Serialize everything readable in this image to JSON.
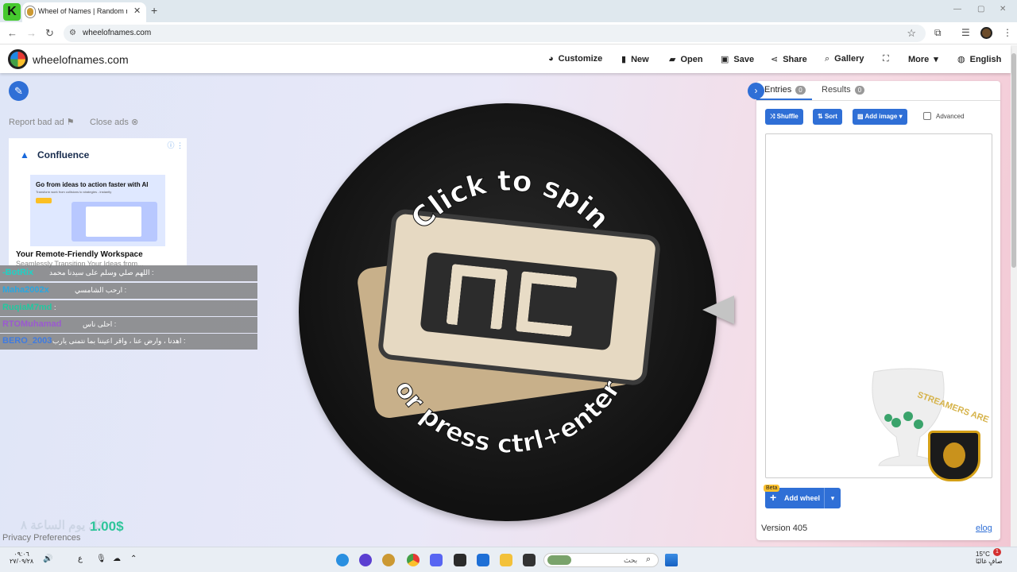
{
  "browser": {
    "tab_logo": "K",
    "tab_title": "Wheel of Names | Random nam",
    "tab_close": "✕",
    "new_tab": "+",
    "url": "wheelofnames.com",
    "win_min": "—",
    "win_max": "▢",
    "win_close": "✕"
  },
  "header": {
    "site_name": "wheelofnames.com",
    "menu": [
      {
        "label": "Customize",
        "icon": "palette-icon",
        "glyph": "◕"
      },
      {
        "label": "New",
        "icon": "file-icon",
        "glyph": "▮"
      },
      {
        "label": "Open",
        "icon": "folder-icon",
        "glyph": "▰"
      },
      {
        "label": "Save",
        "icon": "save-icon",
        "glyph": "▣"
      },
      {
        "label": "Share",
        "icon": "share-icon",
        "glyph": "⋖"
      },
      {
        "label": "Gallery",
        "icon": "search-icon",
        "glyph": "⌕"
      },
      {
        "label": "",
        "icon": "fullscreen-icon",
        "glyph": "⛶"
      },
      {
        "label": "More",
        "icon": "chevron-down-icon",
        "glyph": "▾"
      },
      {
        "label": "English",
        "icon": "globe-icon",
        "glyph": "◍"
      }
    ]
  },
  "ad": {
    "report": "Report bad ad",
    "close": "Close ads",
    "brand": "Confluence",
    "image_title": "Go from ideas to action faster with AI",
    "image_sub": "Transform work from collisions to strategies - instantly",
    "title": "Your Remote-Friendly Workspace",
    "desc": "Seamlessly Transition Your Ideas from..."
  },
  "chat": [
    {
      "user": "-BotRix",
      "msg": "اللهم صلي وسلم على سيدنا محمد :",
      "color": "#1fd3c6"
    },
    {
      "user": "Maha2002x",
      "msg": "ارحب الشامسي :",
      "color": "#2aa7e0"
    },
    {
      "user": "RuqiaM7md",
      "msg": ":",
      "color": "#22c8a0"
    },
    {
      "user": "RTOMuhamad",
      "msg": "احلى ناس :",
      "color": "#9b59d0"
    },
    {
      "user": "BERO_2003",
      "msg": "اهدنا ، وارض عنا ، واقر اعيننا بما نتمنى يارب :",
      "color": "#3f7be0"
    }
  ],
  "wheel": {
    "line1": "Click to spin",
    "line2": "or press ctrl+enter"
  },
  "bottom_left": {
    "price": "1.00$",
    "faded": "كل يوم الساعة ٨",
    "privacy": "Privacy Preferences"
  },
  "panel": {
    "entries_label": "Entries",
    "entries_count": "0",
    "results_label": "Results",
    "results_count": "0",
    "shuffle": "Shuffle",
    "sort": "Sort",
    "add_image": "Add image",
    "advanced": "Advanced",
    "beta": "Beta",
    "add_wheel": "Add wheel",
    "version": "Version 405",
    "changelog": "elog"
  },
  "overlay": {
    "streamer_text": "STREAMERS ARE"
  },
  "taskbar": {
    "time": "٠٩:٠٦",
    "date": "٢٧/٠٩/٢٨",
    "lang": "ع",
    "search": "بحث",
    "temp": "15°C",
    "weather": "صافٍ غالبًا",
    "badge": "1"
  },
  "colors": {
    "accent": "#2f6fd6",
    "price": "#2ec59a",
    "beta": "#fbc02d"
  }
}
